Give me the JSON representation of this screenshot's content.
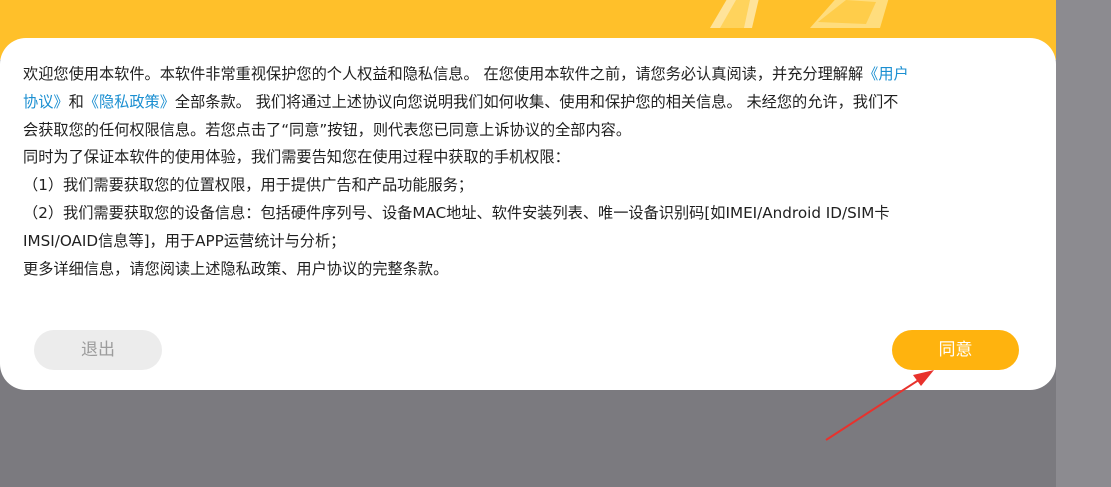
{
  "dialog": {
    "lines": {
      "l1_a": "欢迎您使用本软件。本软件非常重视保护您的个人权益和隐私信息。 在您使用本软件之前，请您务必认真阅读，并充分理解解",
      "l1_link": "《用户",
      "l2_link1": "协议》",
      "l2_and": "和",
      "l2_link2": "《隐私政策》",
      "l2_b": "全部条款。 我们将通过上述协议向您说明我们如何收集、使用和保护您的相关信息。 未经您的允许，我们不",
      "l3": "会获取您的任何权限信息。若您点击了“同意”按钮，则代表您已同意上诉协议的全部内容。",
      "l4": " 同时为了保证本软件的使用体验，我们需要告知您在使用过程中获取的手机权限：",
      "l5": "（1）我们需要获取您的位置权限，用于提供广告和产品功能服务；",
      "l6": "（2）我们需要获取您的设备信息：包括硬件序列号、设备MAC地址、软件安装列表、唯一设备识别码[如IMEI/Android ID/SIM卡",
      "l7": "IMSI/OAID信息等]，用于APP运营统计与分析；",
      "l8": "更多详细信息，请您阅读上述隐私政策、用户协议的完整条款。"
    },
    "buttons": {
      "exit_label": "退出",
      "agree_label": "同意"
    }
  },
  "colors": {
    "banner": "#ffc02a",
    "link": "#1b8fd1",
    "agree": "#ffb30e",
    "annotation_arrow": "#e8322d"
  },
  "annotation": {
    "icon": "red-arrow-icon"
  }
}
